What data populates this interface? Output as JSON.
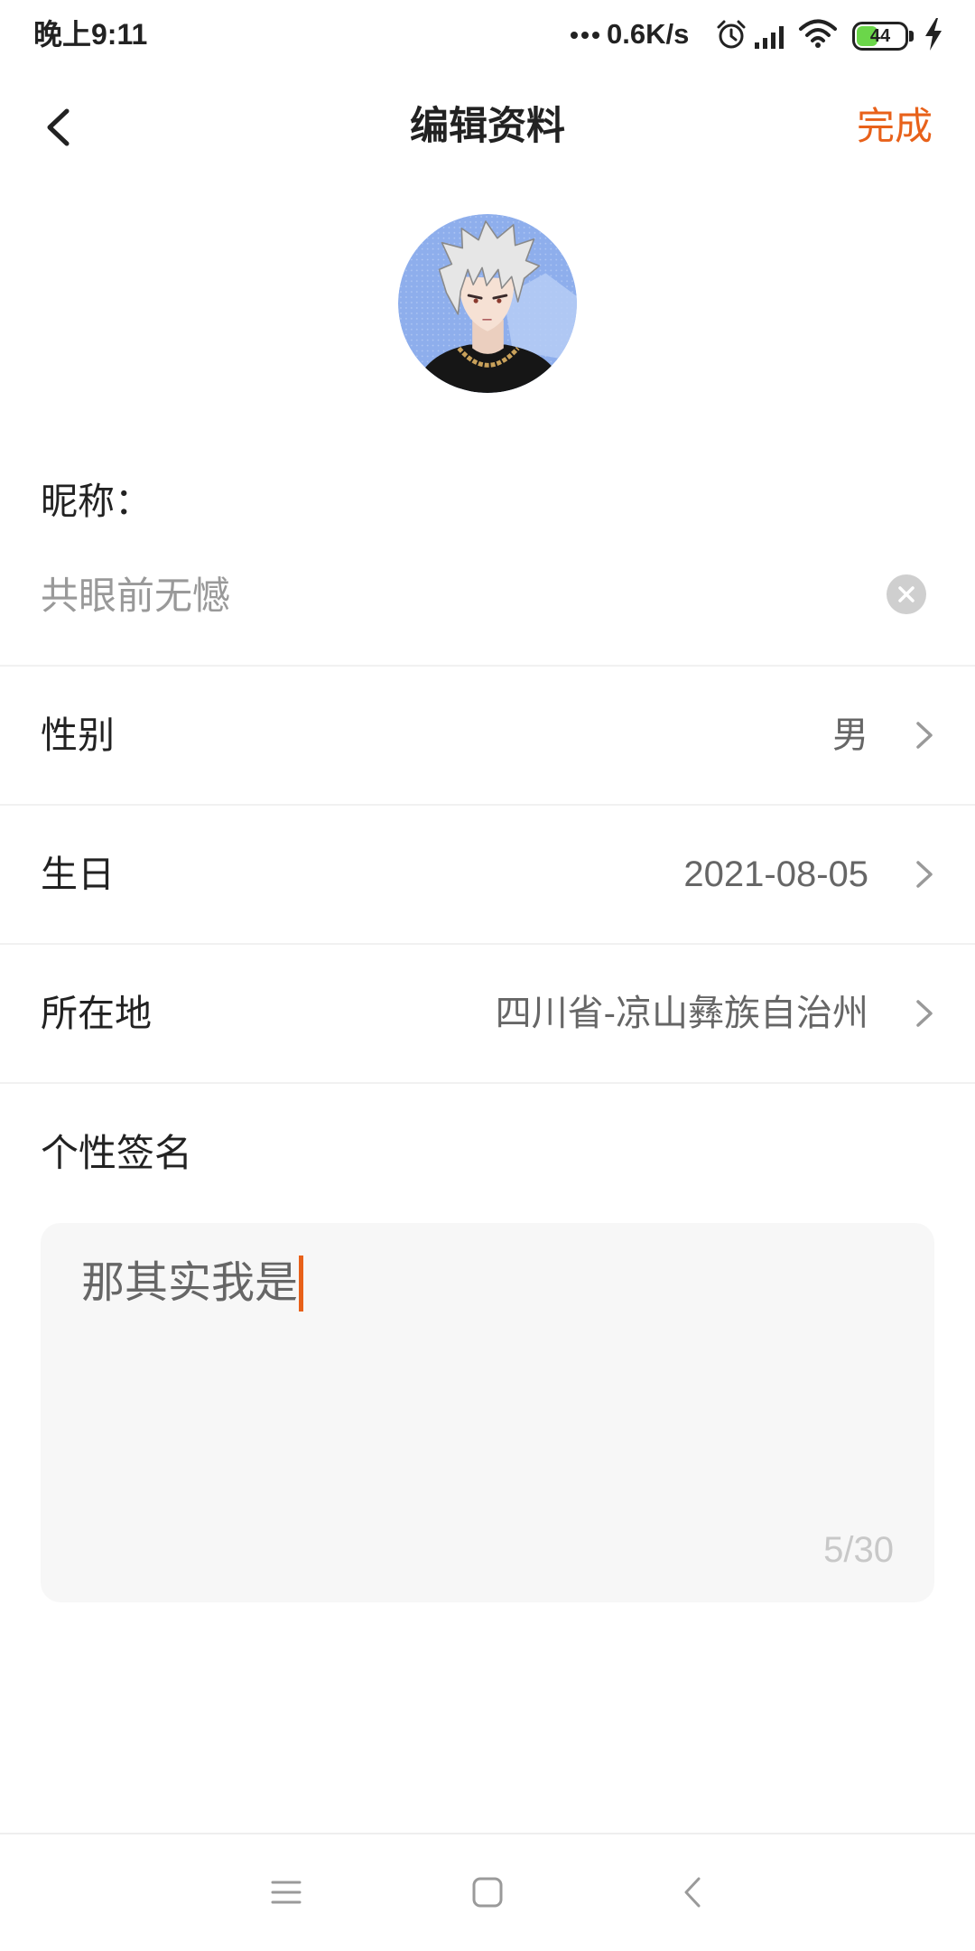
{
  "status_bar": {
    "time": "晚上9:11",
    "network_speed": "0.6K/s",
    "battery_level": 44,
    "icons": [
      "more-notifications-icon",
      "alarm-icon",
      "signal-icon",
      "wifi-icon",
      "battery-icon",
      "charging-icon"
    ]
  },
  "header": {
    "title": "编辑资料",
    "done_label": "完成",
    "back_icon": "back-arrow-icon"
  },
  "avatar": {
    "icon": "avatar-image"
  },
  "nickname": {
    "label": "昵称：",
    "value": "共眼前无憾",
    "clear_icon": "clear-icon"
  },
  "rows": [
    {
      "label": "性别",
      "value": "男",
      "icon": "chevron-right-icon"
    },
    {
      "label": "生日",
      "value": "2021-08-05",
      "icon": "chevron-right-icon"
    },
    {
      "label": "所在地",
      "value": "四川省-凉山彝族自治州",
      "icon": "chevron-right-icon"
    }
  ],
  "signature": {
    "label": "个性签名",
    "value": "那其实我是",
    "counter": "5/30"
  },
  "nav_bar": {
    "icons": [
      "menu-icon",
      "home-icon",
      "back-icon"
    ]
  },
  "colors": {
    "accent": "#E8611A",
    "text_primary": "#222222",
    "text_secondary": "#999999",
    "text_value": "#666666",
    "divider": "#F1F1F1",
    "input_background": "#F7F7F7",
    "battery_fill": "#6BD64A",
    "nav_icon": "#9A9A9A"
  }
}
